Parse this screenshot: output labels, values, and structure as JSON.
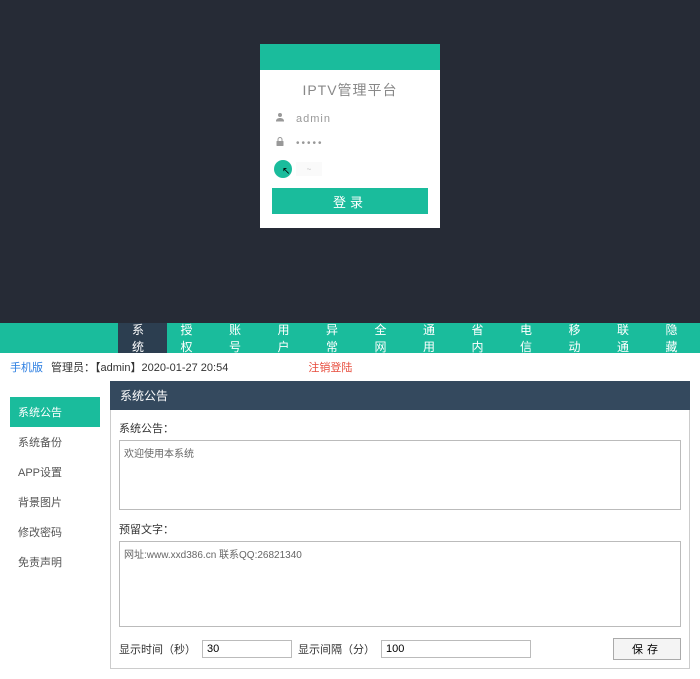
{
  "login": {
    "title": "IPTV管理平台",
    "username": "admin",
    "password_mask": "•••••",
    "captcha_placeholder": "验证",
    "button": "登录"
  },
  "topnav": {
    "items": [
      {
        "label": "系统",
        "active": true
      },
      {
        "label": "授权",
        "active": false
      },
      {
        "label": "账号",
        "active": false
      },
      {
        "label": "用户",
        "active": false
      },
      {
        "label": "异常",
        "active": false
      },
      {
        "label": "全网",
        "active": false
      },
      {
        "label": "通用",
        "active": false
      },
      {
        "label": "省内",
        "active": false
      },
      {
        "label": "电信",
        "active": false
      },
      {
        "label": "移动",
        "active": false
      },
      {
        "label": "联通",
        "active": false
      },
      {
        "label": "隐藏",
        "active": false
      }
    ]
  },
  "status": {
    "mobile": "手机版",
    "admin_prefix": "管理员：",
    "admin_name": "【admin】",
    "timestamp": "2020-01-27 20:54",
    "logout": "注销登陆"
  },
  "sidebar": {
    "items": [
      {
        "label": "系统公告",
        "active": true
      },
      {
        "label": "系统备份",
        "active": false
      },
      {
        "label": "APP设置",
        "active": false
      },
      {
        "label": "背景图片",
        "active": false
      },
      {
        "label": "修改密码",
        "active": false
      },
      {
        "label": "免责声明",
        "active": false
      }
    ]
  },
  "panel": {
    "header": "系统公告",
    "notice_label": "系统公告：",
    "notice_value": "欢迎使用本系统",
    "footer_label": "预留文字：",
    "footer_value": "网址:www.xxd386.cn 联系QQ:26821340",
    "display_time_label": "显示时间（秒）",
    "display_time_value": "30",
    "display_interval_label": "显示间隔（分）",
    "display_interval_value": "100",
    "save": "保存"
  }
}
